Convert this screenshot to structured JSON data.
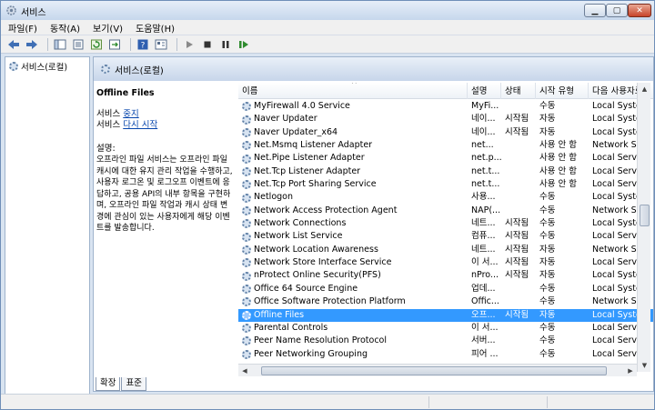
{
  "window": {
    "title": "서비스"
  },
  "menu": [
    "파일(F)",
    "동작(A)",
    "보기(V)",
    "도움말(H)"
  ],
  "toolbar": [
    "back-arrow-icon",
    "forward-arrow-icon",
    "console-tree-icon",
    "properties-icon",
    "refresh-icon",
    "export-icon",
    "help-icon",
    "view-icon",
    "play-icon",
    "stop-icon",
    "pause-icon",
    "restart-icon"
  ],
  "tree": {
    "root": "서비스(로컬)"
  },
  "header": {
    "title": "서비스(로컬)"
  },
  "details": {
    "name": "Offline Files",
    "stop_prefix": "서비스 ",
    "stop_link": "중지",
    "restart_prefix": "서비스 ",
    "restart_link": "다시 시작",
    "desc_label": "설명:",
    "description": "오프라인 파일 서비스는 오프라인 파일 캐시에 대한 유지 관리 작업을 수행하고, 사용자 로그온 및 로그오프 이벤트에 응답하고, 공용 API의 내부 항목을 구현하며, 오프라인 파일 작업과 캐시 상태 변경에 관심이 있는 사용자에게 해당 이벤트를 발송합니다."
  },
  "columns": {
    "name": "이름",
    "desc": "설명",
    "status": "상태",
    "start": "시작 유형",
    "logon": "다음 사용자로"
  },
  "services": [
    {
      "name": "MyFirewall 4.0 Service",
      "desc": "MyFi...",
      "status": "",
      "start": "수동",
      "logon": "Local System"
    },
    {
      "name": "Naver Updater",
      "desc": "네이...",
      "status": "시작됨",
      "start": "자동",
      "logon": "Local System"
    },
    {
      "name": "Naver Updater_x64",
      "desc": "네이...",
      "status": "시작됨",
      "start": "자동",
      "logon": "Local System"
    },
    {
      "name": "Net.Msmq Listener Adapter",
      "desc": "net...",
      "status": "",
      "start": "사용 안 함",
      "logon": "Network Service"
    },
    {
      "name": "Net.Pipe Listener Adapter",
      "desc": "net.p...",
      "status": "",
      "start": "사용 안 함",
      "logon": "Local Service"
    },
    {
      "name": "Net.Tcp Listener Adapter",
      "desc": "net.t...",
      "status": "",
      "start": "사용 안 함",
      "logon": "Local Service"
    },
    {
      "name": "Net.Tcp Port Sharing Service",
      "desc": "net.t...",
      "status": "",
      "start": "사용 안 함",
      "logon": "Local Service"
    },
    {
      "name": "Netlogon",
      "desc": "사용...",
      "status": "",
      "start": "수동",
      "logon": "Local System"
    },
    {
      "name": "Network Access Protection Agent",
      "desc": "NAP(...",
      "status": "",
      "start": "수동",
      "logon": "Network Service"
    },
    {
      "name": "Network Connections",
      "desc": "네트...",
      "status": "시작됨",
      "start": "수동",
      "logon": "Local System"
    },
    {
      "name": "Network List Service",
      "desc": "컴퓨...",
      "status": "시작됨",
      "start": "수동",
      "logon": "Local Service"
    },
    {
      "name": "Network Location Awareness",
      "desc": "네트...",
      "status": "시작됨",
      "start": "자동",
      "logon": "Network Service"
    },
    {
      "name": "Network Store Interface Service",
      "desc": "이 서...",
      "status": "시작됨",
      "start": "자동",
      "logon": "Local Service"
    },
    {
      "name": "nProtect Online Security(PFS)",
      "desc": "nPro...",
      "status": "시작됨",
      "start": "자동",
      "logon": "Local System"
    },
    {
      "name": "Office 64 Source Engine",
      "desc": "업데...",
      "status": "",
      "start": "수동",
      "logon": "Local System"
    },
    {
      "name": "Office Software Protection Platform",
      "desc": "Offic...",
      "status": "",
      "start": "수동",
      "logon": "Network Service"
    },
    {
      "name": "Offline Files",
      "desc": "오프...",
      "status": "시작됨",
      "start": "자동",
      "logon": "Local System",
      "selected": true
    },
    {
      "name": "Parental Controls",
      "desc": "이 서...",
      "status": "",
      "start": "수동",
      "logon": "Local Service"
    },
    {
      "name": "Peer Name Resolution Protocol",
      "desc": "서버...",
      "status": "",
      "start": "수동",
      "logon": "Local Service"
    },
    {
      "name": "Peer Networking Grouping",
      "desc": "피어 ...",
      "status": "",
      "start": "수동",
      "logon": "Local Service"
    }
  ],
  "tabs": [
    "확장",
    "표준"
  ]
}
